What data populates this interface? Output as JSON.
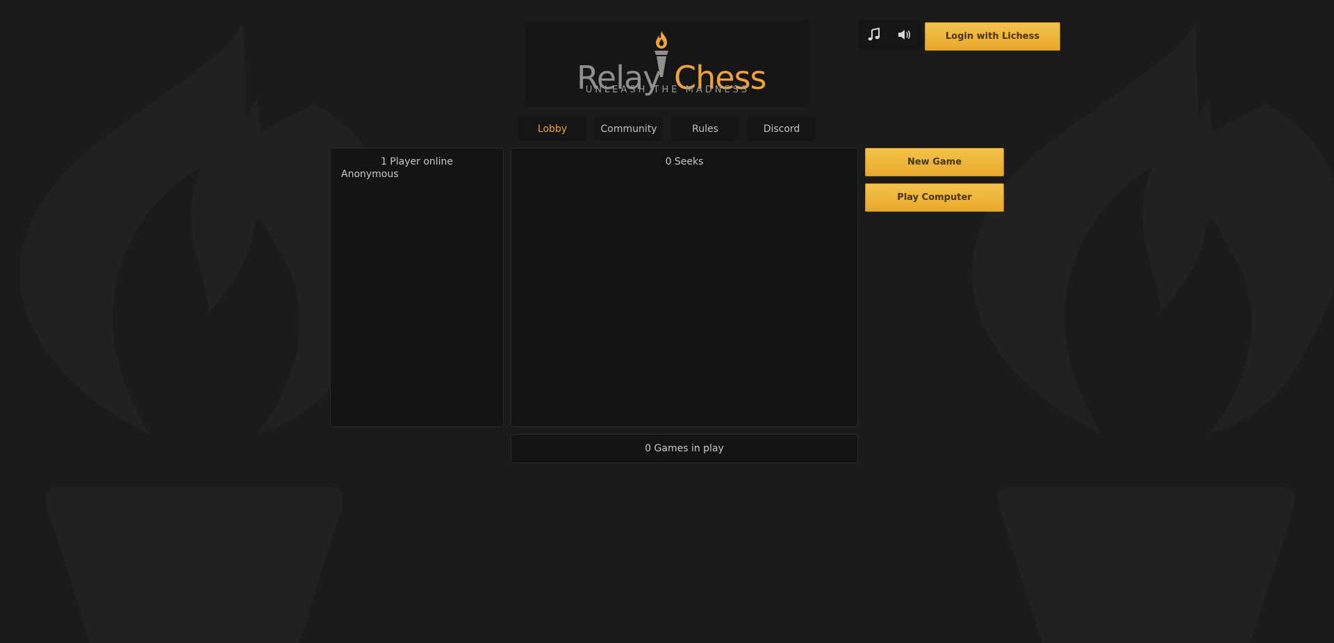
{
  "brand": {
    "word_left": "Relay",
    "word_right": "Chess",
    "tagline": "UNLEASH THE MADNESS",
    "colors": {
      "left": "#8f8f8f",
      "right": "#f0a23a"
    }
  },
  "top_controls": {
    "music_icon": "music-note-icon",
    "sound_icon": "speaker-icon",
    "login_label": "Login with Lichess"
  },
  "nav": {
    "tabs": [
      {
        "label": "Lobby",
        "active": true
      },
      {
        "label": "Community",
        "active": false
      },
      {
        "label": "Rules",
        "active": false
      },
      {
        "label": "Discord",
        "active": false
      }
    ]
  },
  "players": {
    "title": "1 Player online",
    "list": [
      "Anonymous"
    ]
  },
  "seeks": {
    "title": "0 Seeks"
  },
  "games": {
    "label": "0 Games in play"
  },
  "actions": {
    "new_game": "New Game",
    "play_computer": "Play Computer"
  },
  "colors": {
    "accent": "#e6a830",
    "background": "#1b1b1b",
    "panel": "#131313"
  }
}
